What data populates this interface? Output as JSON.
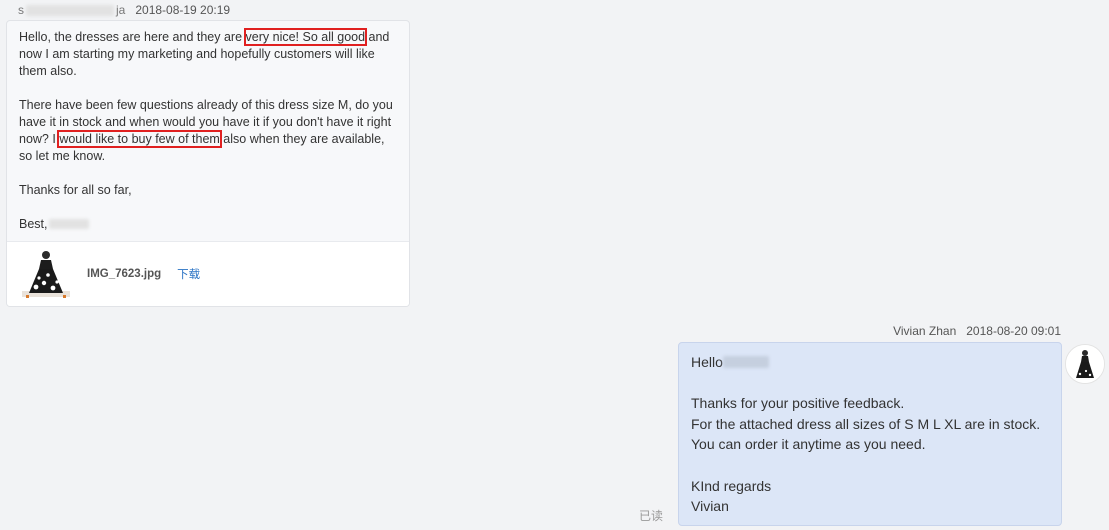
{
  "incoming": {
    "sender_prefix": "s",
    "sender_suffix": "ja",
    "timestamp": "2018-08-19 20:19",
    "para1_before": "Hello, the dresses are here and they are ",
    "para1_highlight": "very nice! So all good",
    "para1_after": " and now I am starting my marketing and hopefully customers will like them also.",
    "para2_before": "There have been few questions already of this dress size M, do you have it in stock and when would you have it if you don't have it right now? I ",
    "para2_highlight": "would like to buy few of them",
    "para2_after": " also when they are available, so let me know.",
    "para3": "Thanks for all so far,",
    "sign_off": "Best,",
    "attachment": {
      "file_name": "IMG_7623.jpg",
      "download_label": "下载"
    }
  },
  "outgoing": {
    "sender_name": "Vivian Zhan",
    "timestamp": "2018-08-20 09:01",
    "greeting": "Hello",
    "line1": "Thanks for your positive feedback.",
    "line2": "For the attached dress all sizes of S M L XL are in stock.",
    "line3": "You can order it anytime as you need.",
    "closing": "KInd regards",
    "signature": "Vivian",
    "read_status": "已读"
  },
  "colors": {
    "page_bg": "#f2f3f5",
    "incoming_bubble": "#f7f8fa",
    "outgoing_bubble": "#dce6f7",
    "highlight_box": "#e02020",
    "link": "#2a73c4"
  }
}
